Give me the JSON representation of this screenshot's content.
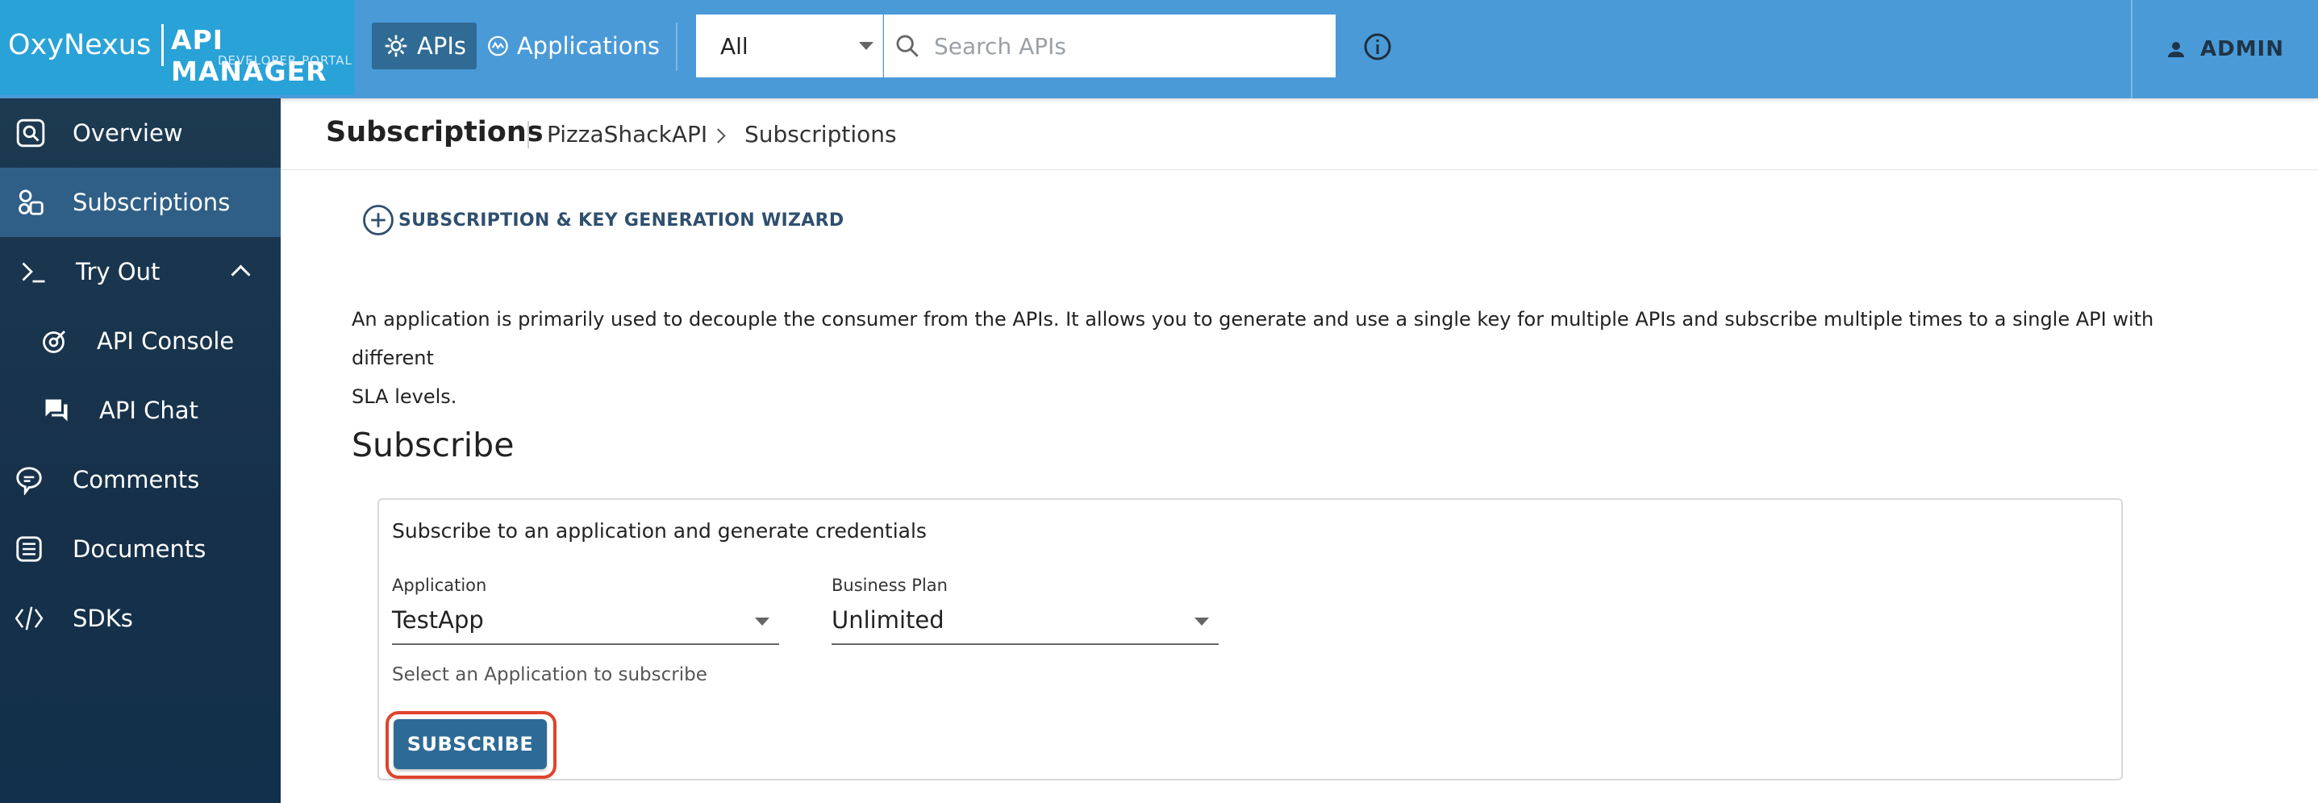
{
  "topbar": {
    "logo_text": "OxyNexus",
    "product_text": "API MANAGER",
    "product_sub": "DEVELOPER PORTAL",
    "nav": [
      {
        "label": "APIs",
        "icon": "gear-icon",
        "active": true
      },
      {
        "label": "Applications",
        "icon": "applications-icon",
        "active": false
      }
    ],
    "filter_value": "All",
    "search_placeholder": "Search APIs",
    "user_label": "ADMIN"
  },
  "sidebar": {
    "items": [
      {
        "label": "Overview",
        "icon": "overview-icon"
      },
      {
        "label": "Subscriptions",
        "icon": "subscriptions-icon",
        "active": true
      },
      {
        "label": "Try Out",
        "icon": "terminal-icon",
        "expanded": true
      },
      {
        "label": "API Console",
        "icon": "console-icon"
      },
      {
        "label": "API Chat",
        "icon": "chat-icon"
      },
      {
        "label": "Comments",
        "icon": "comments-icon"
      },
      {
        "label": "Documents",
        "icon": "documents-icon"
      },
      {
        "label": "SDKs",
        "icon": "code-icon"
      }
    ]
  },
  "header": {
    "title": "Subscriptions",
    "breadcrumb": [
      "PizzaShackAPI",
      "Subscriptions"
    ]
  },
  "main": {
    "wizard_label": "SUBSCRIPTION & KEY GENERATION WIZARD",
    "description_line1": "An application is primarily used to decouple the consumer from the APIs. It allows you to generate and use a single key for multiple APIs and subscribe multiple times to a single API with different",
    "description_line2": "SLA levels.",
    "section_title": "Subscribe",
    "card": {
      "intro": "Subscribe to an application and generate credentials",
      "application_label": "Application",
      "application_value": "TestApp",
      "plan_label": "Business Plan",
      "plan_value": "Unlimited",
      "helper": "Select an Application to subscribe",
      "subscribe_label": "SUBSCRIBE"
    }
  },
  "colors": {
    "topbar": "#4a9ad8",
    "logo_bg": "#29a2d8",
    "sidebar": "#1d3a51",
    "sidebar_active": "#2f5f86",
    "primary_button": "#2d6a96",
    "highlight": "#e0432c"
  }
}
